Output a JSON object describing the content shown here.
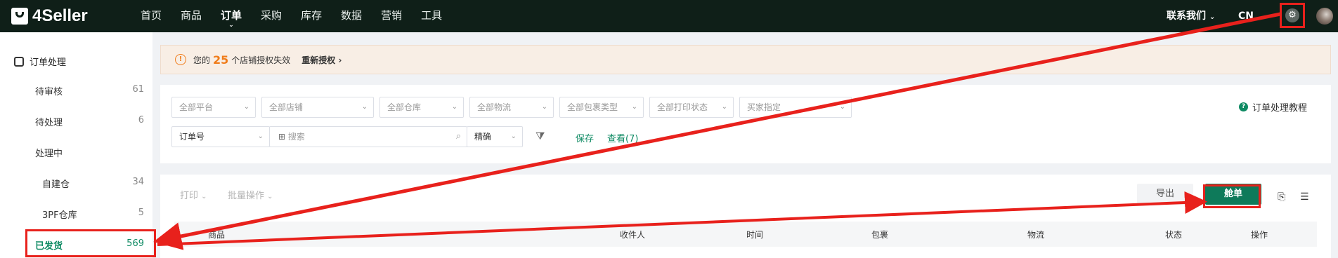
{
  "brand": "4Seller",
  "nav": [
    "首页",
    "商品",
    "订单",
    "采购",
    "库存",
    "数据",
    "营销",
    "工具"
  ],
  "nav_active": "订单",
  "contact": "联系我们",
  "lang": "CN",
  "sidebar": {
    "title": "订单处理",
    "items": [
      {
        "label": "待审核",
        "count": "61"
      },
      {
        "label": "待处理",
        "count": "6"
      },
      {
        "label": "处理中",
        "count": ""
      },
      {
        "label": "自建仓",
        "count": "34"
      },
      {
        "label": "3PF仓库",
        "count": "5"
      },
      {
        "label": "已发货",
        "count": "569"
      }
    ]
  },
  "alert": {
    "prefix": "您的",
    "number": "25",
    "suffix": "个店铺授权失效",
    "action": "重新授权"
  },
  "filters": {
    "row1": [
      "全部平台",
      "全部店铺",
      "全部仓库",
      "全部物流",
      "全部包裹类型",
      "全部打印状态",
      "买家指定"
    ],
    "field": "订单号",
    "search_placeholder": "搜索",
    "match": "精确",
    "save": "保存",
    "view": "查看(7)",
    "tutorial": "订单处理教程"
  },
  "toolbar": {
    "print": "打印",
    "batch": "批量操作",
    "export": "导出",
    "ship": "舱单"
  },
  "table_headers": [
    "商品",
    "收件人",
    "时间",
    "包裹",
    "物流",
    "状态",
    "操作"
  ],
  "annotation_color": "#e8211c"
}
